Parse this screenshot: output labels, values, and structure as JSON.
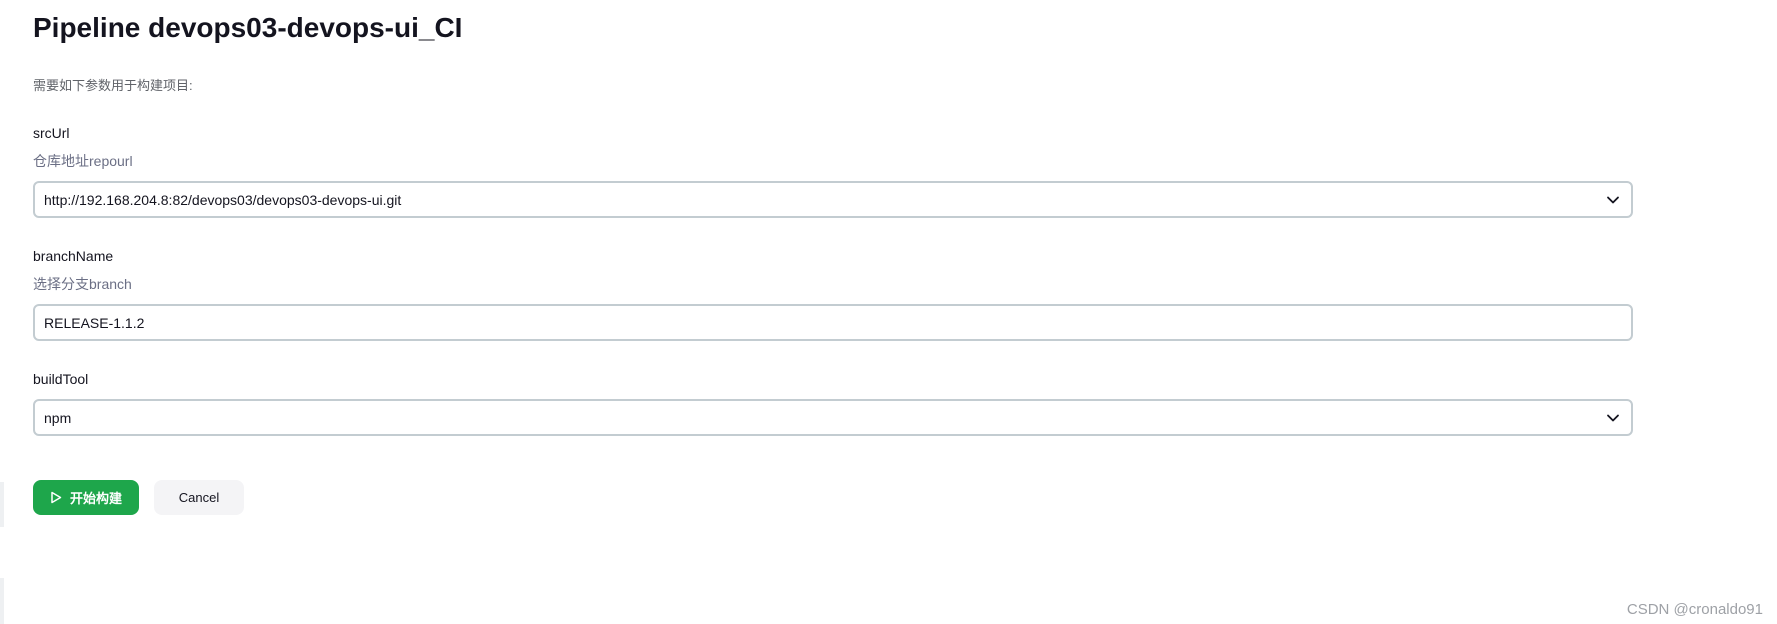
{
  "page": {
    "title": "Pipeline devops03-devops-ui_CI",
    "intro": "需要如下参数用于构建项目:"
  },
  "params": [
    {
      "name": "srcUrl",
      "description": "仓库地址repourl",
      "type": "select",
      "value": "http://192.168.204.8:82/devops03/devops03-devops-ui.git"
    },
    {
      "name": "branchName",
      "description": "选择分支branch",
      "type": "text",
      "value": "RELEASE-1.1.2"
    },
    {
      "name": "buildTool",
      "description": "",
      "type": "select",
      "value": "npm"
    }
  ],
  "actions": {
    "build_label": "开始构建",
    "cancel_label": "Cancel"
  },
  "icons": {
    "build": "play-icon",
    "dropdown": "chevron-down-icon"
  },
  "colors": {
    "build_button": "#1ea64b",
    "field_border": "#c3ccd1",
    "description_text": "#6b6f85"
  },
  "watermark": "CSDN @cronaldo91"
}
